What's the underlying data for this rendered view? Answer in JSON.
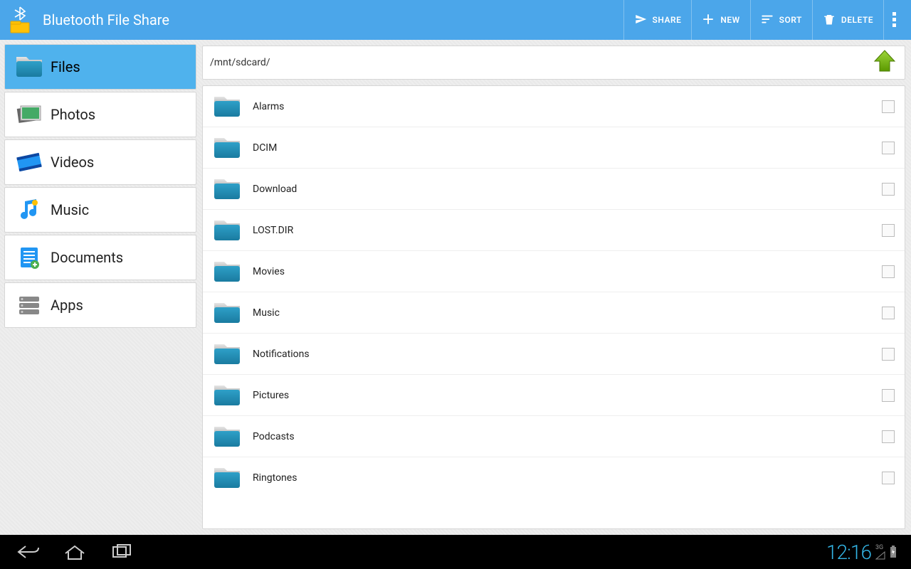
{
  "header": {
    "title": "Bluetooth File Share",
    "actions": {
      "share": "SHARE",
      "new": "NEW",
      "sort": "SORT",
      "delete": "DELETE"
    }
  },
  "sidebar": {
    "items": [
      {
        "label": "Files",
        "icon": "folder"
      },
      {
        "label": "Photos",
        "icon": "photos"
      },
      {
        "label": "Videos",
        "icon": "videos"
      },
      {
        "label": "Music",
        "icon": "music"
      },
      {
        "label": "Documents",
        "icon": "documents"
      },
      {
        "label": "Apps",
        "icon": "apps"
      }
    ],
    "selected_index": 0
  },
  "content": {
    "path": "/mnt/sdcard/",
    "folders": [
      {
        "name": "Alarms"
      },
      {
        "name": "DCIM"
      },
      {
        "name": "Download"
      },
      {
        "name": "LOST.DIR"
      },
      {
        "name": "Movies"
      },
      {
        "name": "Music"
      },
      {
        "name": "Notifications"
      },
      {
        "name": "Pictures"
      },
      {
        "name": "Podcasts"
      },
      {
        "name": "Ringtones"
      }
    ]
  },
  "statusbar": {
    "time": "12:16",
    "network": "3G"
  }
}
